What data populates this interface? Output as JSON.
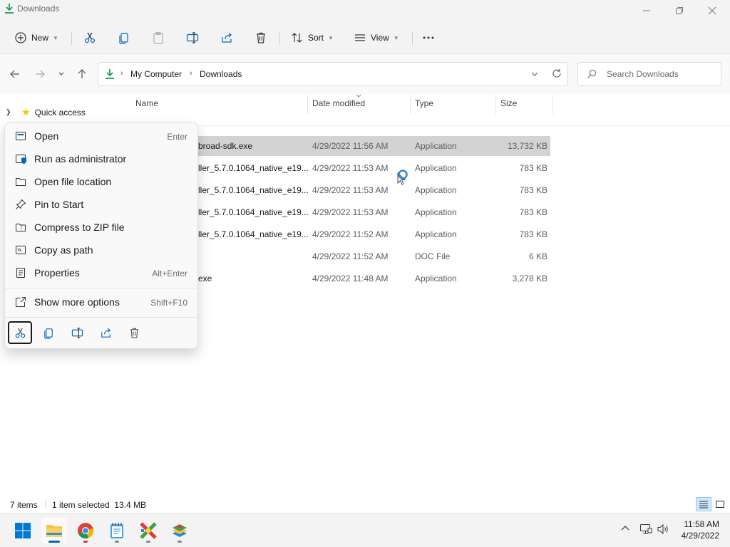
{
  "window": {
    "title": "Downloads"
  },
  "toolbar": {
    "new_label": "New",
    "sort_label": "Sort",
    "view_label": "View"
  },
  "address": {
    "crumbs": [
      "My Computer",
      "Downloads"
    ],
    "search_placeholder": "Search Downloads"
  },
  "nav": {
    "quick_access": "Quick access"
  },
  "columns": {
    "name": "Name",
    "date": "Date modified",
    "type": "Type",
    "size": "Size"
  },
  "files": [
    {
      "name": "broad-sdk.exe",
      "date": "4/29/2022 11:56 AM",
      "type": "Application",
      "size": "13,732 KB"
    },
    {
      "name": "ller_5.7.0.1064_native_e19...",
      "date": "4/29/2022 11:53 AM",
      "type": "Application",
      "size": "783 KB"
    },
    {
      "name": "ller_5.7.0.1064_native_e19...",
      "date": "4/29/2022 11:53 AM",
      "type": "Application",
      "size": "783 KB"
    },
    {
      "name": "ller_5.7.0.1064_native_e19...",
      "date": "4/29/2022 11:53 AM",
      "type": "Application",
      "size": "783 KB"
    },
    {
      "name": "ller_5.7.0.1064_native_e19...",
      "date": "4/29/2022 11:52 AM",
      "type": "Application",
      "size": "783 KB"
    },
    {
      "name": "",
      "date": "4/29/2022 11:52 AM",
      "type": "DOC File",
      "size": "6 KB"
    },
    {
      "name": "exe",
      "date": "4/29/2022 11:48 AM",
      "type": "Application",
      "size": "3,278 KB"
    }
  ],
  "context_menu": {
    "items": [
      {
        "label": "Open",
        "shortcut": "Enter",
        "icon": "window-icon"
      },
      {
        "label": "Run as administrator",
        "shortcut": "",
        "icon": "shield-window-icon"
      },
      {
        "label": "Open file location",
        "shortcut": "",
        "icon": "folder-icon"
      },
      {
        "label": "Pin to Start",
        "shortcut": "",
        "icon": "pin-icon"
      },
      {
        "label": "Compress to ZIP file",
        "shortcut": "",
        "icon": "zip-folder-icon"
      },
      {
        "label": "Copy as path",
        "shortcut": "",
        "icon": "copy-path-icon"
      },
      {
        "label": "Properties",
        "shortcut": "Alt+Enter",
        "icon": "properties-icon"
      }
    ],
    "more": {
      "label": "Show more options",
      "shortcut": "Shift+F10",
      "icon": "external-icon"
    }
  },
  "status": {
    "count": "7 items",
    "selection": "1 item selected  13.4 MB"
  },
  "taskbar": {
    "apps": [
      "start-icon",
      "file-explorer-icon",
      "chrome-icon",
      "notepad-icon",
      "color-app-icon",
      "bluestacks-icon"
    ],
    "time": "11:58 AM",
    "date": "4/29/2022"
  },
  "colors": {
    "accent": "#0067c0",
    "selection": "#cce8ff",
    "hover_selected": "#d3d3d3",
    "star": "#f4c20d"
  }
}
